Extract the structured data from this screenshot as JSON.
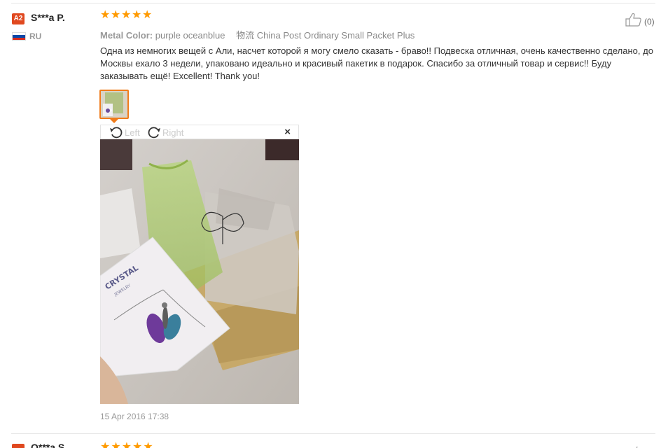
{
  "review": {
    "level_badge": "A2",
    "user_name": "S***a P.",
    "country": "RU",
    "rating": 5,
    "metal_color_label": "Metal Color:",
    "metal_color_value": "purple oceanblue",
    "shipping_label": "物流",
    "shipping_value": "China Post Ordinary Small Packet Plus",
    "text": "Одна из немногих вещей с Али, насчет которой я могу смело сказать - браво!! Подвеска отличная, очень качественно сделано, до Москвы ехало 3 недели, упаковано идеально и красивый пакетик в подарок. Спасибо за отличный товар и сервис!! Буду заказывать ещё! Excellent! Thank you!",
    "likes": "(0)",
    "date": "15 Apr 2016 17:38"
  },
  "viewer": {
    "rotate_left": "Left",
    "rotate_right": "Right",
    "close": "×",
    "card_text_1": "CRYSTAL",
    "card_text_2": "JEWELRY"
  },
  "next_review": {
    "user_name": "O***a S."
  },
  "colors": {
    "accent": "#f07c1b",
    "star": "#ff9a00",
    "badge": "#e0481f"
  }
}
